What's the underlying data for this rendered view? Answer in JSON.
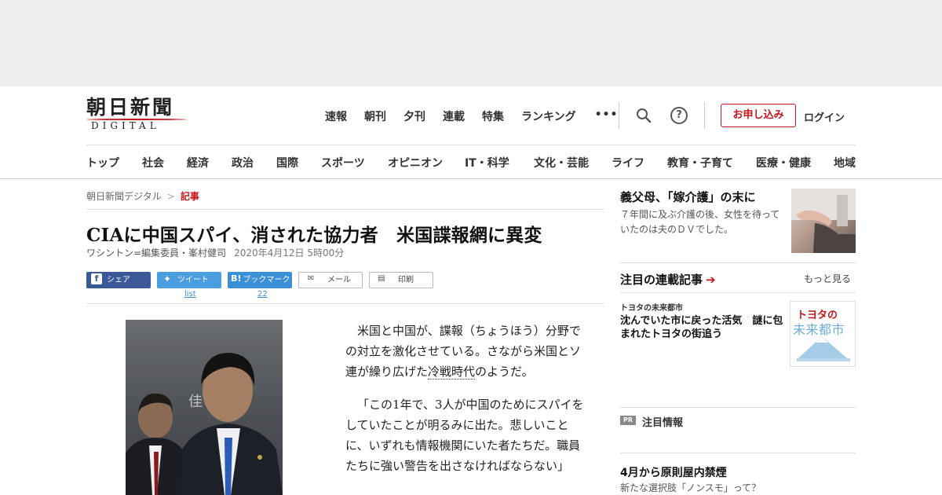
{
  "logo": {
    "main": "朝日新聞",
    "sub": "DIGITAL"
  },
  "topnav": [
    "速報",
    "朝刊",
    "夕刊",
    "連載",
    "特集",
    "ランキング",
    "•••"
  ],
  "header": {
    "subscribe": "お申し込み",
    "login": "ログイン",
    "help": "?"
  },
  "catnav": [
    "トップ",
    "社会",
    "経済",
    "政治",
    "国際",
    "スポーツ",
    "オピニオン",
    "IT・科学",
    "文化・芸能",
    "ライフ",
    "教育・子育て",
    "医療・健康",
    "地域"
  ],
  "breadcrumb": {
    "home": "朝日新聞デジタル",
    "current": "記事"
  },
  "article": {
    "title": "CIAに中国スパイ、消された協力者　米国諜報網に異変",
    "byline": "ワシントン=編集委員・峯村健司",
    "date": "2020年4月12日 5時00分",
    "paragraphs": [
      {
        "before": "米国と中国が、諜報（ちょうほう）分野での対立を激化させている。さながら米国とソ連が繰り広げた",
        "term": "冷戦時代",
        "after": "のようだ。"
      },
      {
        "before": "「この1年で、3人が中国のためにスパイをしていたことが明るみに出た。悲しいことに、いずれも情報機関にいた者たちだ。職員たちに強い警告を出さなければならない」",
        "term": "",
        "after": ""
      }
    ],
    "photo_watermark": "佳"
  },
  "share": {
    "facebook": "シェア",
    "twitter": "ツイート",
    "hatena": "ブックマーク",
    "mail": "メール",
    "print": "印刷",
    "twitter_count": "list",
    "hatena_count": "22"
  },
  "sidebar": {
    "top_title": "義父母、「嫁介護」の末に",
    "top_summary": "７年間に及ぶ介護の後、女性を待っていたのは夫のＤＶでした。",
    "series_heading": "注目の連載記事",
    "series_more": "もっと見る",
    "series_label": "トヨタの未来都市",
    "series_title": "沈んでいた市に戻った活気　謎に包まれたトヨタの街追う",
    "series_thumb_1": "トヨタの",
    "series_thumb_2": "未来都市",
    "pr_badge": "PR",
    "pr_label": "注目情報",
    "bottom_title": "4月から原則屋内禁煙",
    "bottom_summary": "新たな選択肢「ノンスモ」って？"
  },
  "colors": {
    "brand_red": "#c4161c",
    "facebook": "#3b5998",
    "twitter": "#4a9ee0",
    "hatena": "#3a8fd6"
  }
}
